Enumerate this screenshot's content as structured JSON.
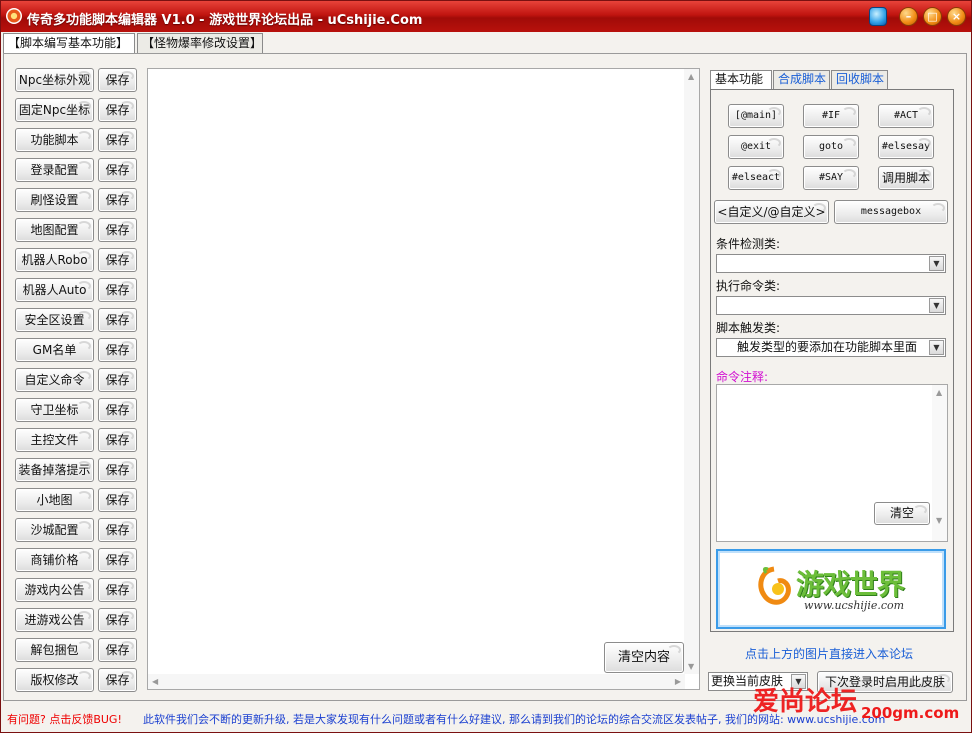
{
  "window": {
    "title": "传奇多功能脚本编辑器 V1.0 - 游戏世界论坛出品 - uCshijie.Com"
  },
  "main_tabs": [
    {
      "label": "【脚本编写基本功能】",
      "active": true
    },
    {
      "label": "【怪物爆率修改设置】",
      "active": false
    }
  ],
  "left_buttons": [
    "Npc坐标外观",
    "固定Npc坐标",
    "功能脚本",
    "登录配置",
    "刷怪设置",
    "地图配置",
    "机器人Robo",
    "机器人Auto",
    "安全区设置",
    "GM名单",
    "自定义命令",
    "守卫坐标",
    "主控文件",
    "装备掉落提示",
    "小地图",
    "沙城配置",
    "商铺价格",
    "游戏内公告",
    "进游戏公告",
    "解包捆包",
    "版权修改"
  ],
  "save_label": "保存",
  "editor": {
    "clear_label": "清空内容"
  },
  "right_tabs": [
    {
      "label": "基本功能",
      "active": true
    },
    {
      "label": "合成脚本",
      "active": false
    },
    {
      "label": "回收脚本",
      "active": false
    }
  ],
  "script_buttons": [
    "[@main]",
    "#IF",
    "#ACT",
    "@exit",
    "goto",
    "#elsesay",
    "#elseact",
    "#SAY",
    "调用脚本"
  ],
  "custom_button": "<自定义/@自定义>",
  "messagebox_button": "messagebox",
  "condition_label": "条件检测类:",
  "condition_value": "",
  "execute_label": "执行命令类:",
  "execute_value": "",
  "trigger_label": "脚本触发类:",
  "trigger_value": "触发类型的要添加在功能脚本里面",
  "note_label": "命令注释:",
  "note_clear": "清空",
  "banner": {
    "logo_text": "游戏世界",
    "logo_url": "www.ucshijie.com"
  },
  "banner_link": "点击上方的图片直接进入本论坛",
  "skin_select": "更换当前皮肤",
  "skin_apply": "下次登录时启用此皮肤",
  "status": {
    "question": "有问题? 点击反馈BUG!",
    "message": "此软件我们会不断的更新升级, 若是大家发现有什么问题或者有什么好建议, 那么请到我们的论坛的综合交流区发表帖子, 我们的网站: www.ucshijie.com"
  },
  "watermark": {
    "text": "爱尚论坛",
    "url": "200gm.com"
  },
  "colors": {
    "title_bar": "#c0140f",
    "link": "#1a5fd6",
    "note_label": "#d10fd1",
    "status_question": "#ee0000",
    "status_message": "#1a3fd0"
  }
}
